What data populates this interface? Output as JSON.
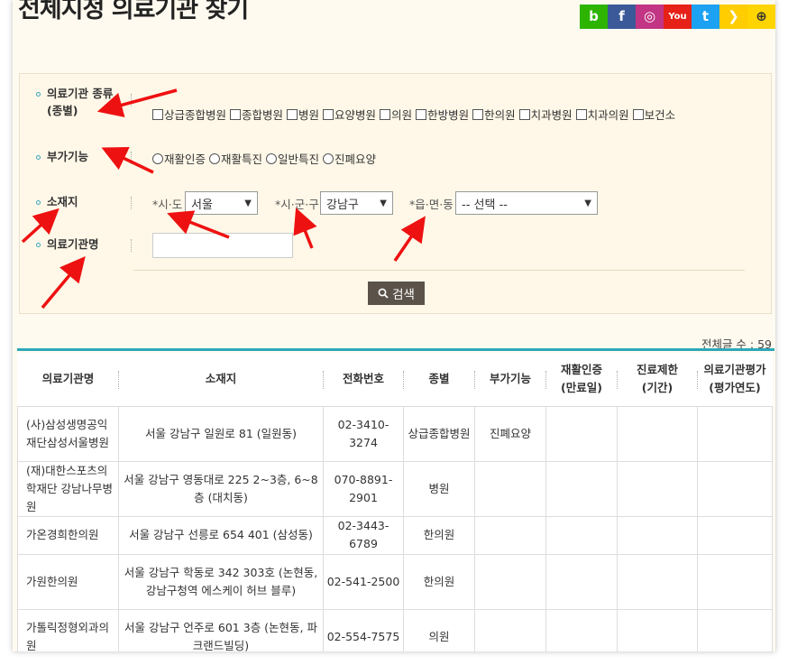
{
  "page": {
    "title": "전체지정 의료기관 찾기"
  },
  "social": [
    {
      "icon": "blog-icon",
      "glyph": "b",
      "color": "#2db400"
    },
    {
      "icon": "facebook-icon",
      "glyph": "f",
      "color": "#3b5998"
    },
    {
      "icon": "instagram-icon",
      "glyph": "◎",
      "color": "#c13584"
    },
    {
      "icon": "youtube-icon",
      "glyph": "You",
      "color": "#e62117"
    },
    {
      "icon": "twitter-icon",
      "glyph": "t",
      "color": "#1da1f2"
    },
    {
      "icon": "kakaostory-icon",
      "glyph": "❯",
      "color": "#ffcd00"
    },
    {
      "icon": "plus-icon",
      "glyph": "+",
      "color": "#ffd400"
    }
  ],
  "filters": {
    "type_label_line1": "의료기관 종류",
    "type_label_line2": "(종별)",
    "types": [
      "상급종합병원",
      "종합병원",
      "병원",
      "요양병원",
      "의원",
      "한방병원",
      "한의원",
      "치과병원",
      "치과의원",
      "보건소"
    ],
    "extra_label": "부가기능",
    "extras": [
      "재활인증",
      "재활특진",
      "일반특진",
      "진폐요양"
    ],
    "location_label": "소재지",
    "sido_label": "*시·도",
    "sido_value": "서울",
    "sigungu_label": "*시·군·구",
    "sigungu_value": "강남구",
    "eupmyeon_label": "*읍·면·동",
    "eupmyeon_value": "-- 선택 --",
    "name_label": "의료기관명",
    "search_button": "검색"
  },
  "total_count": "전체글 수 : 59",
  "table": {
    "headers": [
      {
        "l1": "의료기관명",
        "l2": ""
      },
      {
        "l1": "소재지",
        "l2": ""
      },
      {
        "l1": "전화번호",
        "l2": ""
      },
      {
        "l1": "종별",
        "l2": ""
      },
      {
        "l1": "부가기능",
        "l2": ""
      },
      {
        "l1": "재활인증",
        "l2": "(만료일)"
      },
      {
        "l1": "진료제한",
        "l2": "(기간)"
      },
      {
        "l1": "의료기관평가",
        "l2": "(평가연도)"
      }
    ],
    "rows": [
      {
        "name": "(사)삼성생명공익재단삼성서울병원",
        "address": "서울 강남구 일원로 81 (일원동)",
        "phone": "02-3410-3274",
        "type": "상급종합병원",
        "extra": "진폐요양",
        "cert": "",
        "limit": "",
        "eval": ""
      },
      {
        "name": "(재)대한스포츠의학재단 강남나무병원",
        "address": "서울 강남구 영동대로 225 2~3층, 6~8층 (대치동)",
        "phone": "070-8891-2901",
        "type": "병원",
        "extra": "",
        "cert": "",
        "limit": "",
        "eval": ""
      },
      {
        "name": "가온경희한의원",
        "address": "서울 강남구 선릉로 654 401 (삼성동)",
        "phone": "02-3443-6789",
        "type": "한의원",
        "extra": "",
        "cert": "",
        "limit": "",
        "eval": ""
      },
      {
        "name": "가원한의원",
        "address": "서울 강남구 학동로 342 303호 (논현동, 강남구청역 에스케이 허브 블루)",
        "phone": "02-541-2500",
        "type": "한의원",
        "extra": "",
        "cert": "",
        "limit": "",
        "eval": ""
      },
      {
        "name": "가톨릭정형외과의원",
        "address": "서울 강남구 언주로 601 3층 (논현동, 파크랜드빌딩)",
        "phone": "02-554-7575",
        "type": "의원",
        "extra": "",
        "cert": "",
        "limit": "",
        "eval": ""
      }
    ]
  }
}
